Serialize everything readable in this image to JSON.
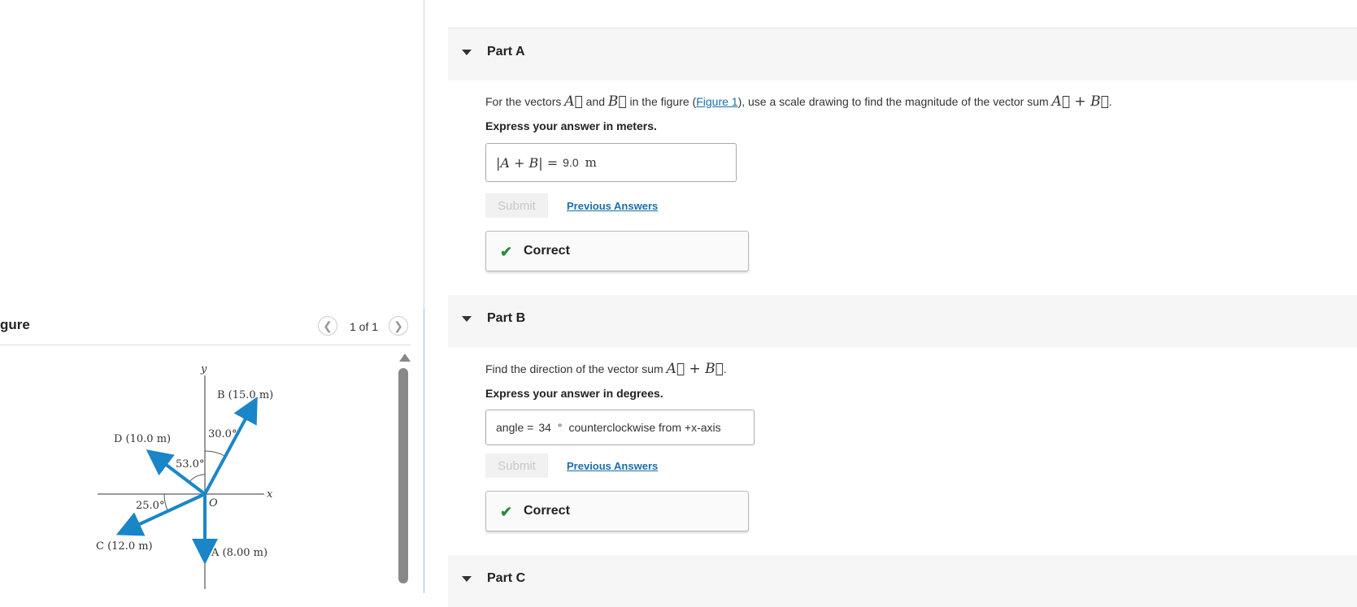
{
  "figure_panel": {
    "title": "gure",
    "pager_text": "1 of 1",
    "prev_icon": "chevron-left-icon",
    "next_icon": "chevron-right-icon",
    "labels": {
      "y_axis": "y",
      "x_axis": "x",
      "origin": "O",
      "vec_b": "B (15.0 m)",
      "vec_d": "D (10.0 m)",
      "vec_c": "C (12.0 m)",
      "vec_a": "A  (8.00 m)",
      "angle_30": "30.0°",
      "angle_53": "53.0°",
      "angle_25": "25.0°"
    },
    "vector_color": "#1a86c8"
  },
  "parts": [
    {
      "title": "Part A"
    },
    {
      "title": "Part B"
    },
    {
      "title": "Part C"
    }
  ],
  "partA": {
    "q_prefix": "For the vectors ",
    "q_and": " and ",
    "q_mid": " in the figure (",
    "figure_link": "Figure 1",
    "q_suffix": "), use a scale drawing to find the magnitude of the vector sum ",
    "instruction": "Express your answer in meters.",
    "answer_label": "|A + B| =",
    "answer_value": "9.0",
    "answer_unit": "m",
    "submit": "Submit",
    "previous": "Previous Answers",
    "result": "Correct"
  },
  "partB": {
    "q_prefix": "Find the direction of the vector sum ",
    "instruction": "Express your answer in degrees.",
    "answer_label": "angle =",
    "answer_value": "34",
    "answer_unit": "°",
    "answer_suffix": "counterclockwise from +x-axis",
    "submit": "Submit",
    "previous": "Previous Answers",
    "result": "Correct"
  },
  "colors": {
    "accent": "#1a6fa8",
    "correct": "#2e8b3a"
  }
}
